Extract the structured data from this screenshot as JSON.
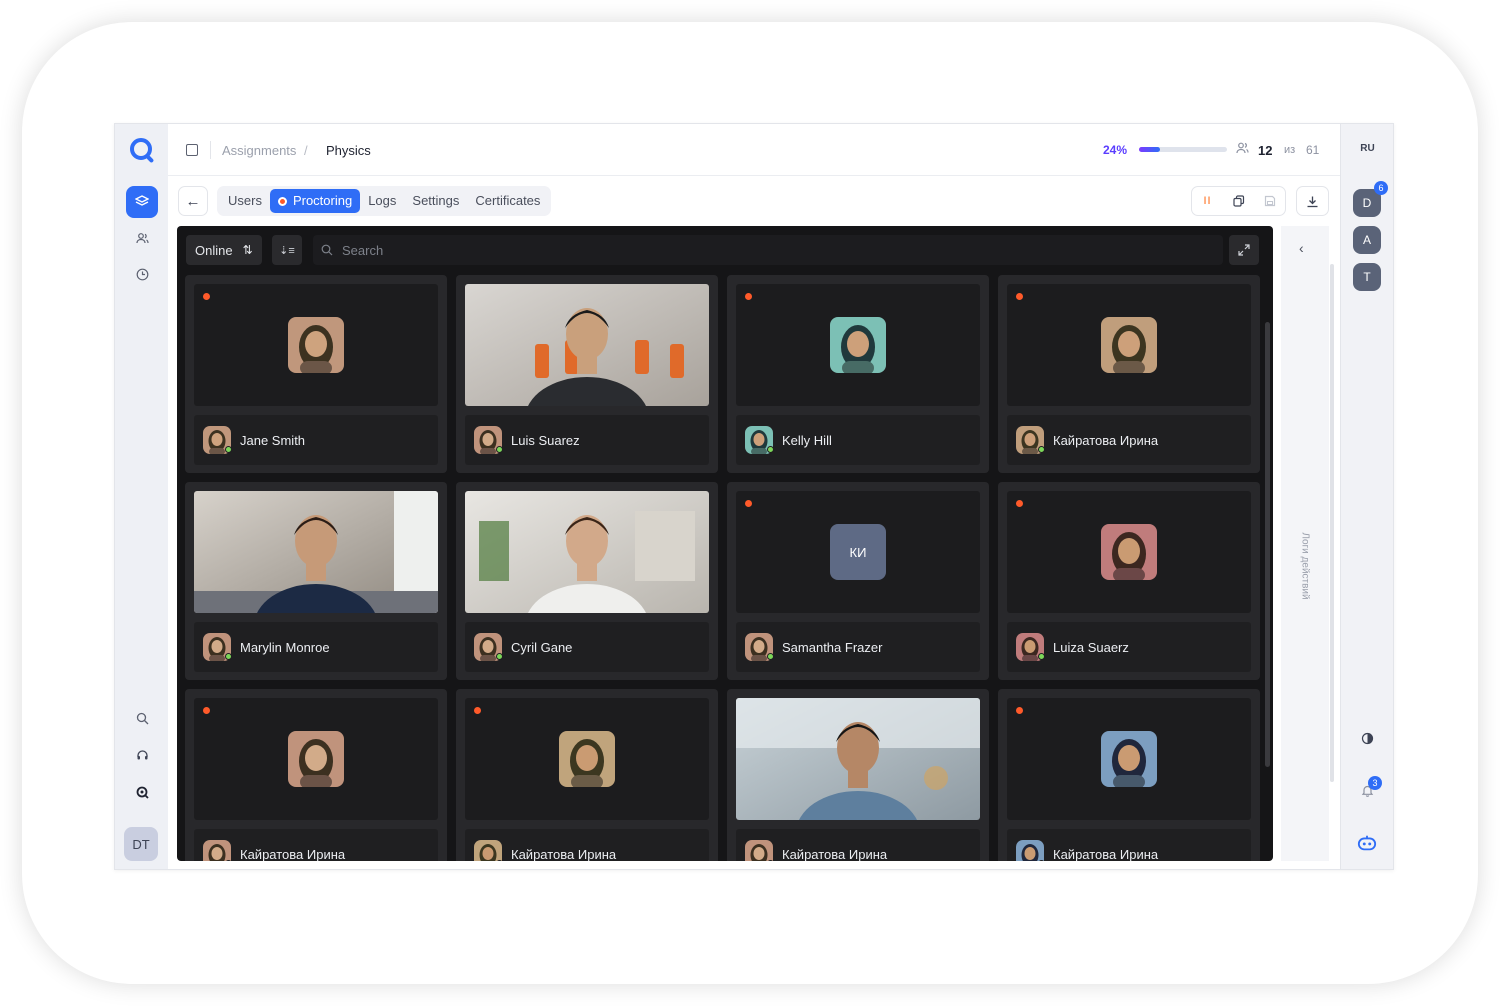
{
  "header": {
    "breadcrumb": [
      "Assignments",
      "Physics"
    ],
    "breadcrumb_separator": "/",
    "progress": {
      "label": "24%",
      "value": 0.24
    },
    "participants": {
      "online": "12",
      "of_label": "из",
      "total": "61"
    }
  },
  "tabs": [
    {
      "label": "Users"
    },
    {
      "label": "Proctoring",
      "active": true
    },
    {
      "label": "Logs"
    },
    {
      "label": "Settings"
    },
    {
      "label": "Certificates"
    }
  ],
  "filter": {
    "status_label": "Online"
  },
  "search": {
    "placeholder": "Search"
  },
  "right_rail": {
    "language": "RU",
    "avatars": [
      "D",
      "A",
      "T"
    ],
    "avatar_badge": "6",
    "notifications_badge": "3"
  },
  "left_rail": {
    "user_initials": "DT"
  },
  "log_panel": {
    "title": "Логи действий"
  },
  "participants": [
    {
      "name": "Jane Smith",
      "camera": "avatar",
      "hue": 24
    },
    {
      "name": "Luis Suarez",
      "camera": "video",
      "scene": "office"
    },
    {
      "name": "Kelly Hill",
      "camera": "avatar",
      "hue": 170
    },
    {
      "name": "Кайратова Ирина",
      "camera": "avatar",
      "hue": 30
    },
    {
      "name": "Marylin Monroe",
      "camera": "video",
      "scene": "home"
    },
    {
      "name": "Cyril Gane",
      "camera": "video",
      "scene": "room"
    },
    {
      "name": "Samantha Frazer",
      "camera": "initials",
      "initials": "КИ"
    },
    {
      "name": "Luiza Suaerz",
      "camera": "avatar",
      "hue": 0
    },
    {
      "name": "Кайратова Ирина",
      "camera": "avatar",
      "hue": 20
    },
    {
      "name": "Кайратова Ирина",
      "camera": "avatar",
      "hue": 35
    },
    {
      "name": "Кайратова Ирина",
      "camera": "video",
      "scene": "cafe"
    },
    {
      "name": "Кайратова Ирина",
      "camera": "avatar",
      "hue": 210
    }
  ],
  "colors": {
    "accent": "#2f6df6",
    "recording": "#ff5a2a",
    "online": "#7dd85a",
    "dark_panel": "#151517"
  }
}
